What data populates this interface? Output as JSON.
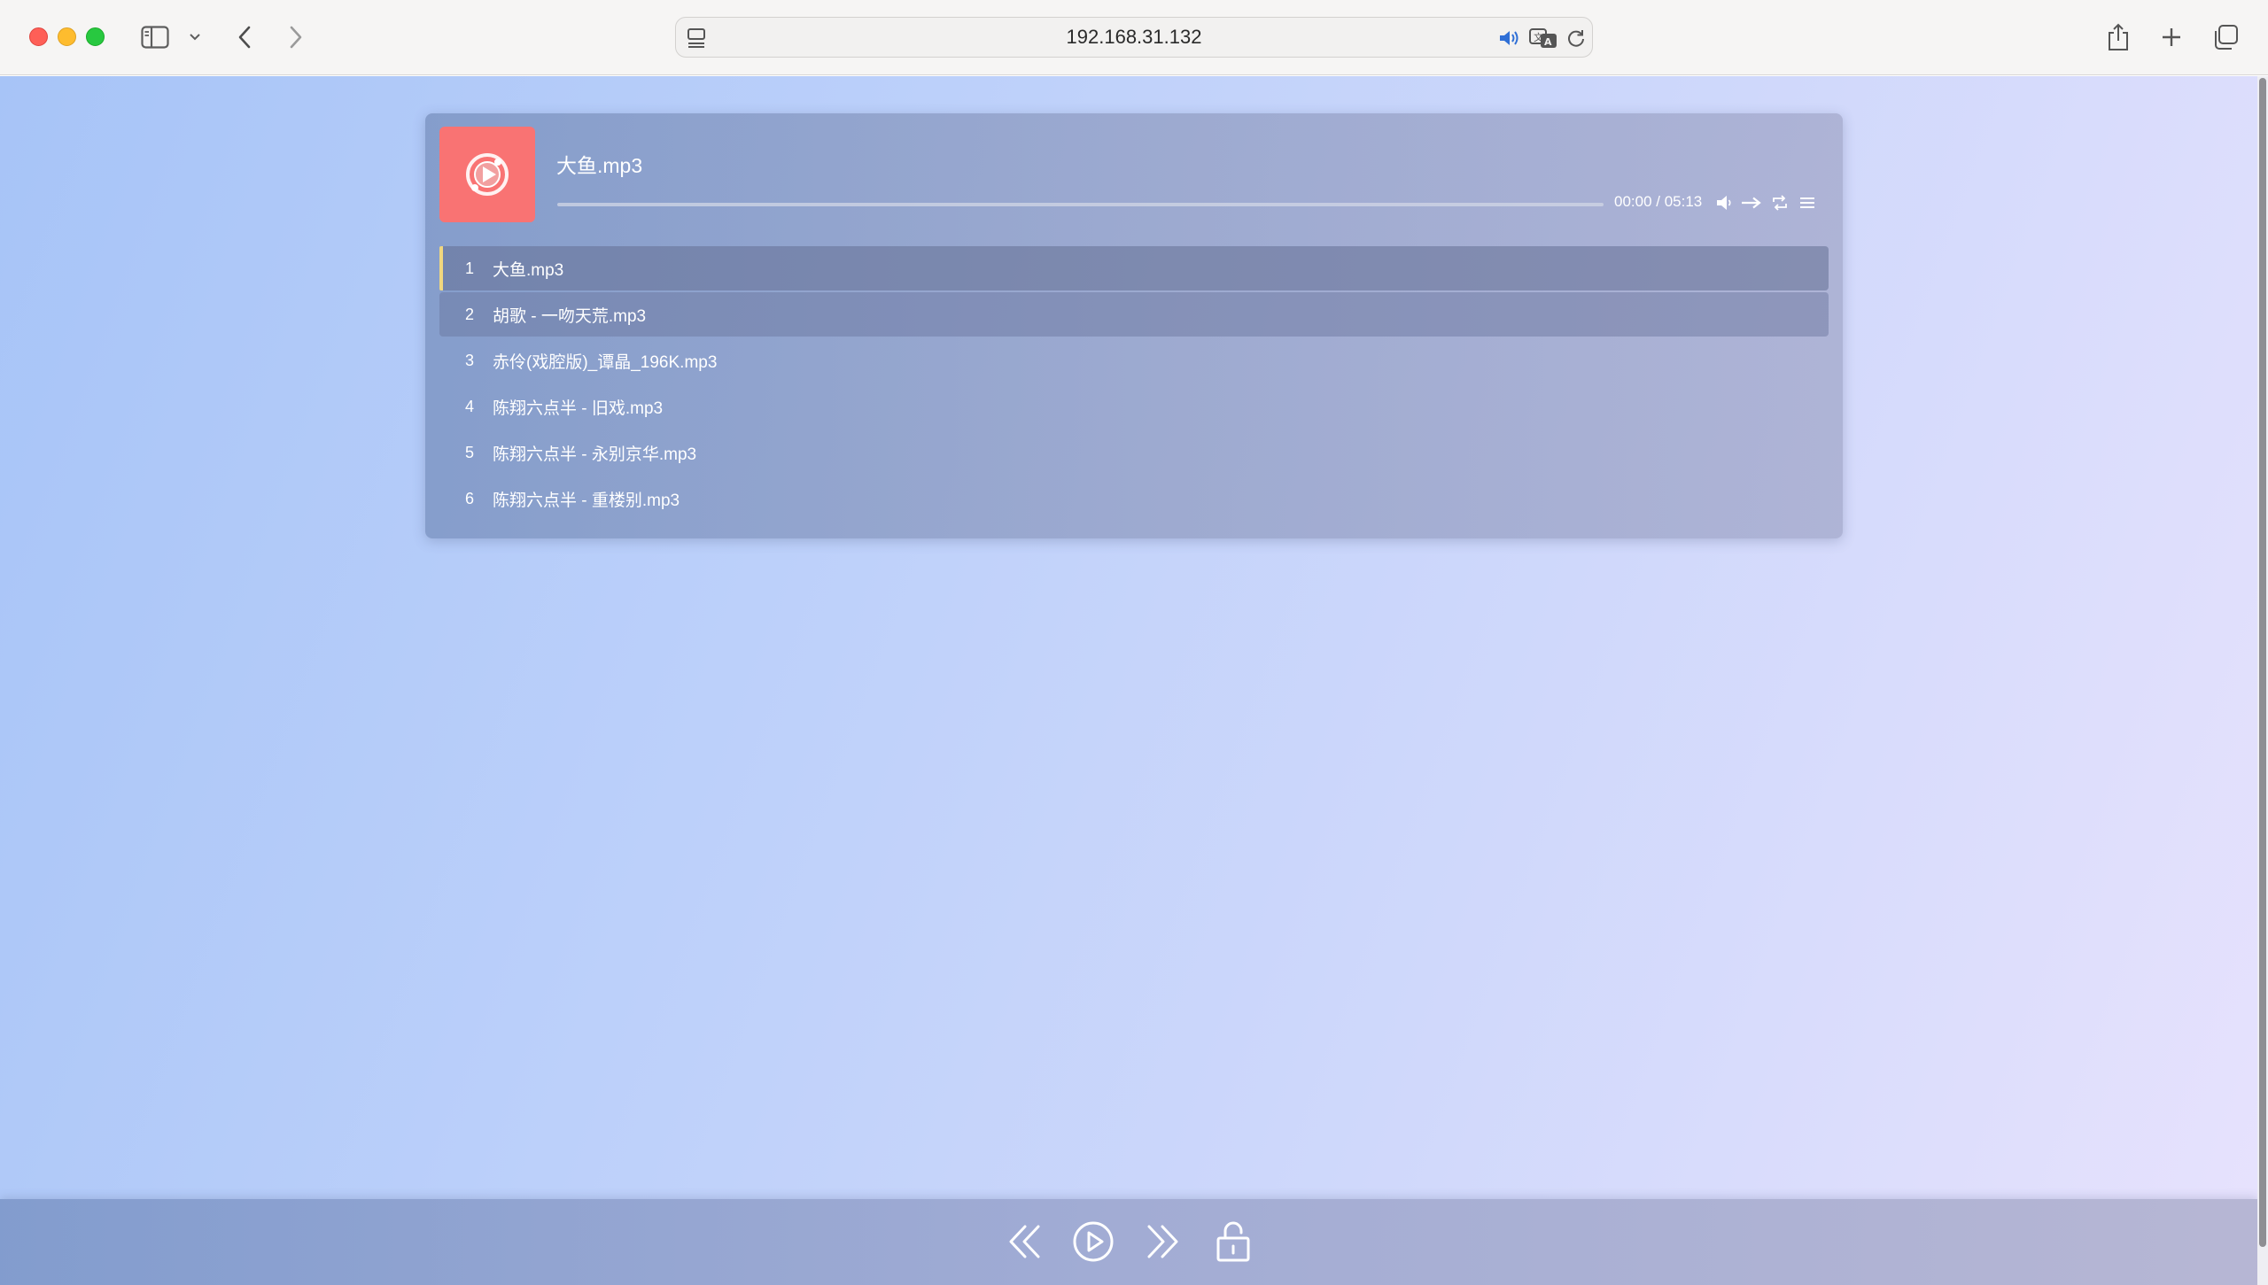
{
  "browser": {
    "url": "192.168.31.132"
  },
  "player": {
    "current_title": "大鱼.mp3",
    "current_time": "00:00",
    "duration": "05:13",
    "time_display": "00:00 / 05:13",
    "progress_fraction": 0.0,
    "cover_color": "#f97373",
    "active_accent": "#f1d77e"
  },
  "playlist": [
    {
      "index": "1",
      "name": "大鱼.mp3",
      "state": "active"
    },
    {
      "index": "2",
      "name": "胡歌 - 一吻天荒.mp3",
      "state": "hover"
    },
    {
      "index": "3",
      "name": "赤伶(戏腔版)_谭晶_196K.mp3",
      "state": "normal"
    },
    {
      "index": "4",
      "name": "陈翔六点半 - 旧戏.mp3",
      "state": "normal"
    },
    {
      "index": "5",
      "name": "陈翔六点半 - 永别京华.mp3",
      "state": "normal"
    },
    {
      "index": "6",
      "name": "陈翔六点半 - 重楼别.mp3",
      "state": "normal"
    }
  ],
  "icons": {
    "volume": "speaker-icon",
    "order": "arrow-right-icon",
    "loop": "repeat-icon",
    "menu": "list-menu-icon",
    "prev": "double-chevron-left-icon",
    "play": "play-circle-icon",
    "next": "double-chevron-right-icon",
    "lock": "unlock-icon"
  }
}
